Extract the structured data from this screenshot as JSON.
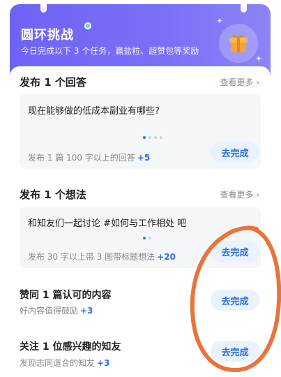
{
  "header": {
    "title": "圆环挑战",
    "subtitle": "今日完成以下 3 个任务，赢盐粒、超赞包等奖励",
    "gift_icon": "gift-icon"
  },
  "sections": [
    {
      "title": "发布 1 个回答",
      "see_more": "查看更多 ›",
      "card_text": "现在能够做的低成本副业有哪些?",
      "description": "发布 1 篇 100 字以上的回答",
      "reward": "+5",
      "button_label": "去完成"
    },
    {
      "title": "发布 1 个想法",
      "see_more": "查看更多 ›",
      "card_text": "和知友们一起讨论 #如何与工作相处 吧",
      "description": "发布 30 字以上带 3 图带标题想法",
      "reward": "+20",
      "button_label": "去完成"
    }
  ],
  "tasks": [
    {
      "title": "赞同 1 篇认可的内容",
      "description": "好内容值得鼓励",
      "reward": "+3",
      "button_label": "去完成"
    },
    {
      "title": "关注 1 位感兴趣的知友",
      "description": "发现志同道合的知友",
      "reward": "+3",
      "button_label": "去完成"
    }
  ],
  "colors": {
    "header_gradient_start": "#6f63f6",
    "accent_blue": "#2f6fd9",
    "button_bg": "#e9f2ff",
    "annotation": "#e8743b",
    "gift": "#f4a43a"
  }
}
